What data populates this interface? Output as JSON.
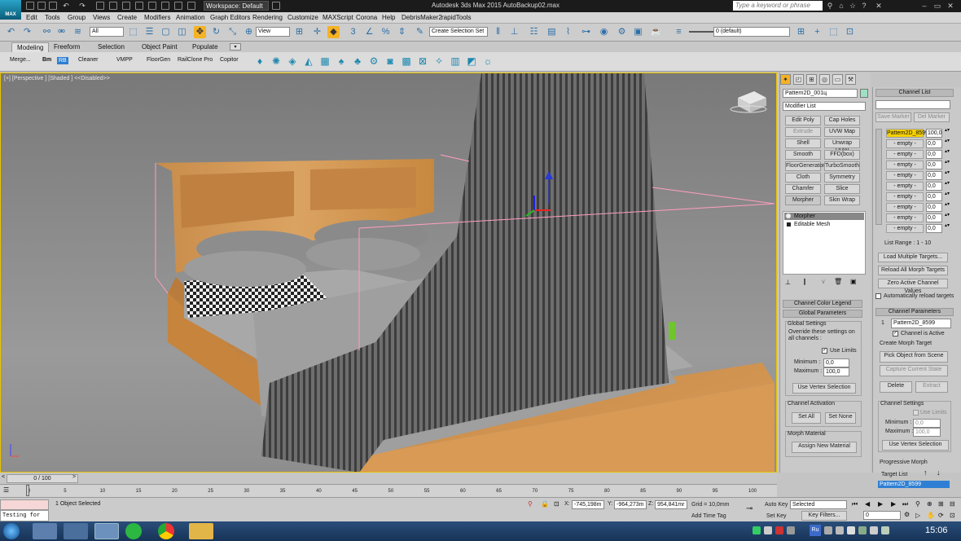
{
  "titlebar": {
    "app_title": "Autodesk 3ds Max  2015      AutoBackup02.max",
    "workspace": "Workspace: Default",
    "search_placeholder": "Type a keyword or phrase",
    "logo": "MAX"
  },
  "menus": [
    "Edit",
    "Tools",
    "Group",
    "Views",
    "Create",
    "Modifiers",
    "Animation",
    "Graph Editors",
    "Rendering",
    "Customize",
    "MAXScript",
    "Corona",
    "Help",
    "DebrisMaker2",
    "rapidTools"
  ],
  "toolbar": {
    "selection_filter": "All",
    "ref_coord": "View",
    "named_sel": "Create Selection Set",
    "layer": "0 (default)"
  },
  "ribbon": {
    "tabs": [
      "Modeling",
      "Freeform",
      "Selection",
      "Object Paint",
      "Populate"
    ],
    "active_tab": "Modeling",
    "items": [
      "Merge...",
      "Bm",
      "RB",
      "Cleaner",
      "VMPP",
      "FloorGen",
      "RailClone Pro",
      "Copitor"
    ]
  },
  "viewport": {
    "label": "[+] [Perspective ] [Shaded ]  <<Disabled>>"
  },
  "command_panel": {
    "object_name": "Pattern2D_001ц",
    "modifier_list": "Modifier List",
    "modifier_buttons": [
      "Edit Poly",
      "Cap Holes",
      "Extrude",
      "UVW Map",
      "Shell",
      "Unwrap UVW",
      "Smooth",
      "FFD(box)",
      "FloorGenerator",
      "TurboSmooth",
      "Cloth",
      "Symmetry",
      "Chamfer",
      "Slice",
      "Morpher",
      "Skin Wrap"
    ],
    "stack": [
      "Morpher",
      "Editable Mesh"
    ],
    "rollouts": {
      "channel_color_legend": "Channel Color Legend",
      "global_parameters": "Global Parameters"
    },
    "global_settings": {
      "title": "Global Settings",
      "desc": "Override these settings on all channels :",
      "use_limits": "Use Limits",
      "minimum_label": "Minimum :",
      "minimum": "0,0",
      "maximum_label": "Maximum :",
      "maximum": "100,0",
      "use_vertex_selection": "Use Vertex Selection"
    },
    "channel_activation": {
      "title": "Channel Activation",
      "set_all": "Set All",
      "set_none": "Set None"
    },
    "morph_material": {
      "title": "Morph Material",
      "assign": "Assign New Material"
    }
  },
  "morph_panel": {
    "channel_list_title": "Channel List",
    "save_marker": "Save Marker",
    "del_marker": "Del Marker",
    "slots": [
      {
        "name": "Pattern2D_8599",
        "value": "100,0"
      },
      {
        "name": "- empty -",
        "value": "0,0"
      },
      {
        "name": "- empty -",
        "value": "0,0"
      },
      {
        "name": "- empty -",
        "value": "0,0"
      },
      {
        "name": "- empty -",
        "value": "0,0"
      },
      {
        "name": "- empty -",
        "value": "0,0"
      },
      {
        "name": "- empty -",
        "value": "0,0"
      },
      {
        "name": "- empty -",
        "value": "0,0"
      },
      {
        "name": "- empty -",
        "value": "0,0"
      },
      {
        "name": "- empty -",
        "value": "0,0"
      }
    ],
    "list_range": "List Range :    1 - 10",
    "load_multiple": "Load Multiple Targets...",
    "reload_all": "Reload All Morph Targets",
    "zero_active": "Zero Active Channel Values",
    "auto_reload": "Automatically reload targets",
    "channel_params_title": "Channel Parameters",
    "channel_num": "1",
    "channel_name": "Pattern2D_8599",
    "channel_active": "Channel is Active",
    "create_morph_target": "Create Morph Target",
    "pick_object": "Pick Object from Scene",
    "capture_state": "Capture Current State",
    "delete": "Delete",
    "extract": "Extract",
    "channel_settings": "Channel Settings",
    "cs_use_limits": "Use Limits",
    "cs_minimum_label": "Minimum :",
    "cs_minimum": "0,0",
    "cs_maximum_label": "Maximum :",
    "cs_maximum": "100,0",
    "cs_use_vertex": "Use Vertex Selection",
    "progressive_morph": "Progressive Morph",
    "target_list": "Target List",
    "target_item": "Pattern2D_8599"
  },
  "timeline": {
    "frame": "0 / 100",
    "ticks": [
      "0",
      "5",
      "10",
      "15",
      "20",
      "25",
      "30",
      "35",
      "40",
      "45",
      "50",
      "55",
      "60",
      "65",
      "70",
      "75",
      "80",
      "85",
      "90",
      "95",
      "100"
    ]
  },
  "status": {
    "objects_selected": "1 Object Selected",
    "x_label": "X:",
    "x": "-745,198m",
    "y_label": "Y:",
    "y": "-964,273m",
    "z_label": "Z:",
    "z": "954,841mr",
    "grid": "Grid = 10,0mm",
    "add_time_tag": "Add Time Tag",
    "auto_key": "Auto Key",
    "auto_key_mode": "Selected",
    "set_key": "Set Key",
    "key_filters": "Key Filters...",
    "frame_field": "0",
    "listener": "Testing for"
  },
  "taskbar": {
    "clock": "15:06",
    "lang": "Ru"
  },
  "colors": {
    "accent": "#f5b225",
    "taskbar": "#1d3d66",
    "selection_blue": "#2e7fd3"
  }
}
